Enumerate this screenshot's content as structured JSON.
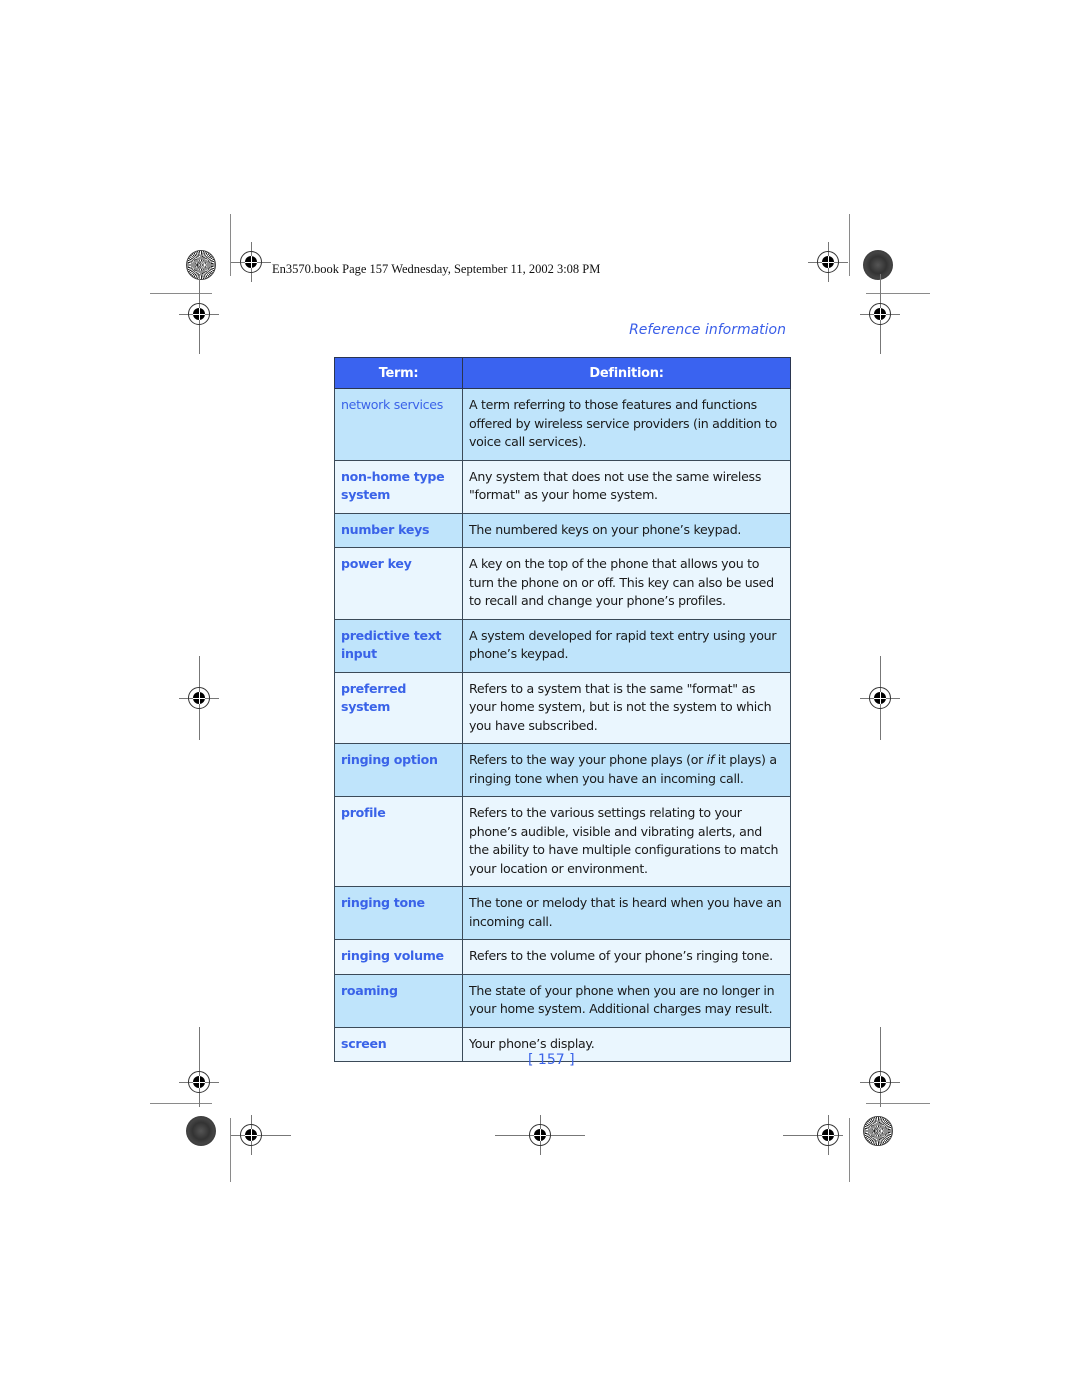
{
  "print_header": "En3570.book  Page 157  Wednesday, September 11, 2002  3:08 PM",
  "section_title": "Reference information",
  "table": {
    "headers": {
      "term": "Term:",
      "definition": "Definition:"
    },
    "rows": [
      {
        "term": "network services",
        "definition": "A term referring to those features and functions offered by wireless service providers (in addition to voice call services)."
      },
      {
        "term": "non-home type system",
        "definition": "Any system that does not use the same wireless \"format\" as your home system."
      },
      {
        "term": "number keys",
        "definition": "The numbered keys on your phone’s keypad."
      },
      {
        "term": "power key",
        "definition": "A key on the top of the phone that allows you to turn the phone on or off. This key can also be used to recall and change your phone’s profiles."
      },
      {
        "term": "predictive text input",
        "definition": "A system developed for rapid text entry using your phone’s keypad."
      },
      {
        "term": "preferred system",
        "definition": "Refers to a system that is the same \"format\" as your home system, but is not the system to which you have subscribed."
      },
      {
        "term": "ringing option",
        "definition_before": "Refers to the way your phone plays (or ",
        "definition_emph": "if",
        "definition_after": " it plays) a ringing tone when you have an incoming call."
      },
      {
        "term": "profile",
        "definition": "Refers to the various settings relating to your phone’s audible, visible and vibrating alerts, and the ability to have multiple configurations to match your location or environment."
      },
      {
        "term": "ringing tone",
        "definition": "The tone or melody that is heard when you have an incoming call."
      },
      {
        "term": "ringing volume",
        "definition": "Refers to the volume of your phone’s ringing tone."
      },
      {
        "term": "roaming",
        "definition": "The state of your phone when you are no longer in your home system. Additional charges may result."
      },
      {
        "term": "screen",
        "definition": "Your phone’s display."
      }
    ]
  },
  "page_number": "[ 157 ]",
  "colors": {
    "accent_blue": "#3a63f0",
    "row_dark": "#bfe4fb",
    "row_light": "#eaf6fe"
  }
}
